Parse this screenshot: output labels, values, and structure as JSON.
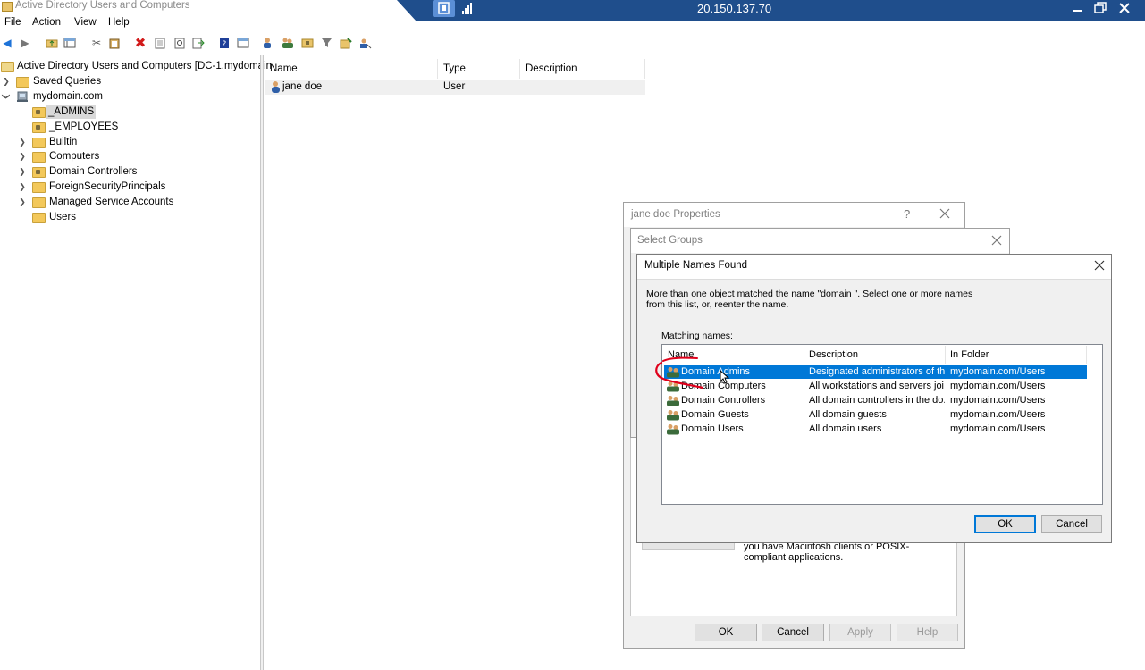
{
  "window": {
    "title": "Active Directory Users and Computers"
  },
  "remote_bar": {
    "ip": "20.150.137.70"
  },
  "menu": [
    "File",
    "Action",
    "View",
    "Help"
  ],
  "tree": {
    "root": "Active Directory Users and Computers [DC-1.mydomain",
    "items": [
      {
        "label": "Saved Queries"
      },
      {
        "label": "mydomain.com"
      },
      {
        "label": "_ADMINS"
      },
      {
        "label": "_EMPLOYEES"
      },
      {
        "label": "Builtin"
      },
      {
        "label": "Computers"
      },
      {
        "label": "Domain Controllers"
      },
      {
        "label": "ForeignSecurityPrincipals"
      },
      {
        "label": "Managed Service Accounts"
      },
      {
        "label": "Users"
      }
    ]
  },
  "list": {
    "columns": [
      "Name",
      "Type",
      "Description"
    ],
    "rows": [
      {
        "name": "jane doe",
        "type": "User",
        "description": ""
      }
    ]
  },
  "properties_dialog": {
    "title": "jane doe Properties",
    "help_glyph": "?",
    "partial_text": "you have Macintosh clients or POSIX-compliant applications.",
    "buttons": {
      "ok": "OK",
      "cancel": "Cancel",
      "apply": "Apply",
      "help": "Help"
    }
  },
  "select_groups_dialog": {
    "title": "Select Groups"
  },
  "multiple_names_dialog": {
    "title": "Multiple Names Found",
    "message_line1": "More than one object matched the name \"domain \". Select one or more names",
    "message_line2": "from this list, or, reenter the name.",
    "matching_label": "Matching names:",
    "columns": [
      "Name",
      "Description",
      "In Folder"
    ],
    "rows": [
      {
        "name": "Domain Admins",
        "description": "Designated administrators of th...",
        "folder": "mydomain.com/Users",
        "selected": true
      },
      {
        "name": "Domain Computers",
        "description": "All workstations and servers joi...",
        "folder": "mydomain.com/Users"
      },
      {
        "name": "Domain Controllers",
        "description": "All domain controllers in the do...",
        "folder": "mydomain.com/Users"
      },
      {
        "name": "Domain Guests",
        "description": "All domain guests",
        "folder": "mydomain.com/Users"
      },
      {
        "name": "Domain Users",
        "description": "All domain users",
        "folder": "mydomain.com/Users"
      }
    ],
    "buttons": {
      "ok": "OK",
      "cancel": "Cancel"
    }
  },
  "colors": {
    "selection": "#0078d7",
    "remote_bar": "#1f4e8c",
    "annotation": "#e0001b"
  }
}
